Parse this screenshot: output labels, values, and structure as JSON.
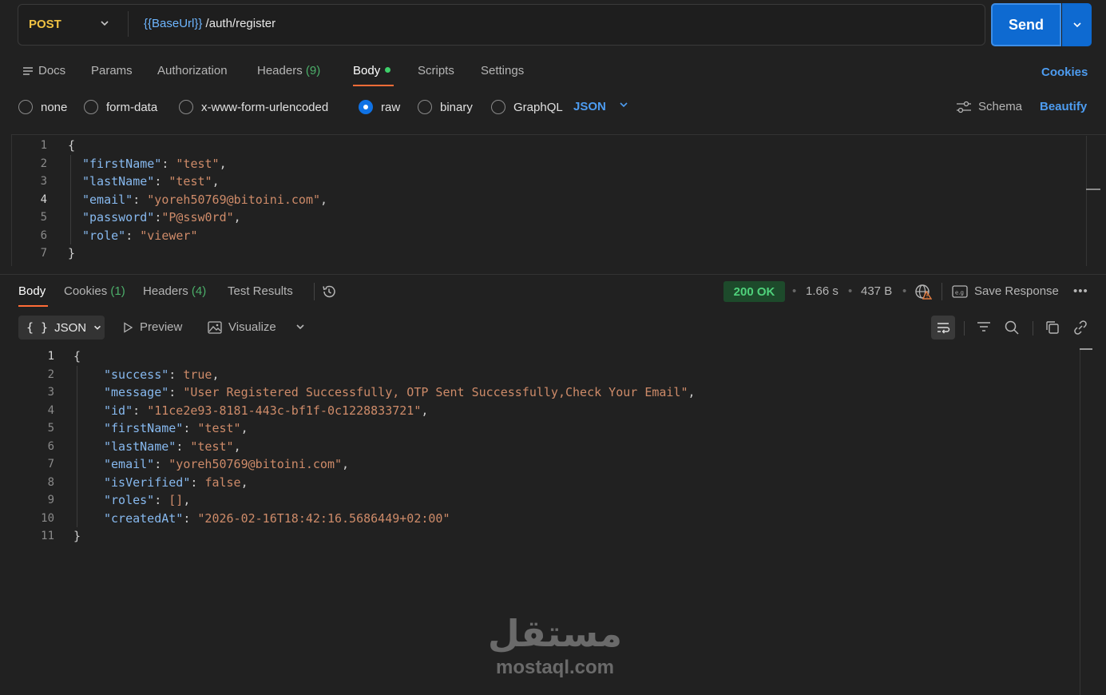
{
  "request": {
    "method": "POST",
    "url_variable": "{{BaseUrl}}",
    "url_path": " /auth/register",
    "send_label": "Send"
  },
  "request_tabs": {
    "docs": "Docs",
    "params": "Params",
    "authorization": "Authorization",
    "headers": "Headers",
    "headers_count": "(9)",
    "body": "Body",
    "scripts": "Scripts",
    "settings": "Settings",
    "cookies": "Cookies"
  },
  "body_types": {
    "none": "none",
    "form_data": "form-data",
    "urlencoded": "x-www-form-urlencoded",
    "raw": "raw",
    "binary": "binary",
    "graphql": "GraphQL",
    "language": "JSON",
    "schema": "Schema",
    "beautify": "Beautify"
  },
  "request_body_lines": [
    {
      "n": "1",
      "text": "{"
    },
    {
      "n": "2",
      "key": "\"firstName\"",
      "sep": ": ",
      "val": "\"test\"",
      "end": ","
    },
    {
      "n": "3",
      "key": "\"lastName\"",
      "sep": ": ",
      "val": "\"test\"",
      "end": ","
    },
    {
      "n": "4",
      "key": "\"email\"",
      "sep": ": ",
      "val": "\"yoreh50769@bitoini.com\"",
      "end": ","
    },
    {
      "n": "5",
      "key": "\"password\"",
      "sep": ":",
      "val": "\"P@ssw0rd\"",
      "end": ","
    },
    {
      "n": "6",
      "key": "\"role\"",
      "sep": ": ",
      "val": "\"viewer\"",
      "end": ""
    },
    {
      "n": "7",
      "text": "}"
    }
  ],
  "response_tabs": {
    "body": "Body",
    "cookies": "Cookies",
    "cookies_count": "(1)",
    "headers": "Headers",
    "headers_count": "(4)",
    "test_results": "Test Results"
  },
  "response_meta": {
    "status": "200 OK",
    "time": "1.66 s",
    "size": "437 B",
    "save_response": "Save Response"
  },
  "response_toolbar": {
    "format": "JSON",
    "preview": "Preview",
    "visualize": "Visualize"
  },
  "response_body_lines": [
    {
      "n": "1",
      "text": "{"
    },
    {
      "n": "2",
      "key": "\"success\"",
      "sep": ": ",
      "val": "true",
      "end": ","
    },
    {
      "n": "3",
      "key": "\"message\"",
      "sep": ": ",
      "val": "\"User Registered Successfully, OTP Sent Successfully,Check Your Email\"",
      "end": ","
    },
    {
      "n": "4",
      "key": "\"id\"",
      "sep": ": ",
      "val": "\"11ce2e93-8181-443c-bf1f-0c1228833721\"",
      "end": ","
    },
    {
      "n": "5",
      "key": "\"firstName\"",
      "sep": ": ",
      "val": "\"test\"",
      "end": ","
    },
    {
      "n": "6",
      "key": "\"lastName\"",
      "sep": ": ",
      "val": "\"test\"",
      "end": ","
    },
    {
      "n": "7",
      "key": "\"email\"",
      "sep": ": ",
      "val": "\"yoreh50769@bitoini.com\"",
      "end": ","
    },
    {
      "n": "8",
      "key": "\"isVerified\"",
      "sep": ": ",
      "val": "false",
      "end": ","
    },
    {
      "n": "9",
      "key": "\"roles\"",
      "sep": ": ",
      "val": "[]",
      "end": ","
    },
    {
      "n": "10",
      "key": "\"createdAt\"",
      "sep": ": ",
      "val": "\"2026-02-16T18:42:16.5686449+02:00\"",
      "end": ""
    },
    {
      "n": "11",
      "text": "}"
    }
  ],
  "watermark": {
    "arabic": "مستقل",
    "latin": "mostaql.com"
  },
  "colors": {
    "accent_send": "#0e6ad1",
    "method": "#f0c242",
    "json_key": "#87b9ef",
    "json_string": "#ce8b69",
    "status_ok": "#4fd17b",
    "active_tab_underline": "#ff6c37"
  }
}
